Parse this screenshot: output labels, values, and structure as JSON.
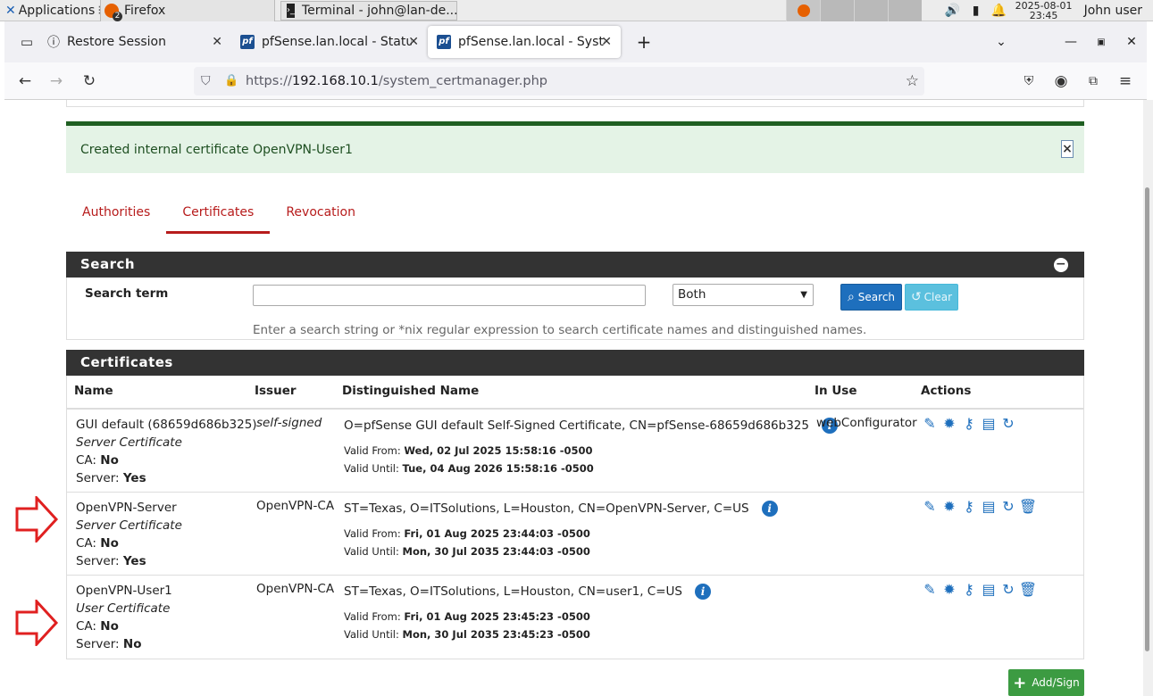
{
  "desktop_panel": {
    "apps_label": "Applications",
    "firefox_task": "Firefox",
    "firefox_badge": "2",
    "terminal_task": "Terminal - john@lan-de...",
    "clock_date": "2025-08-01",
    "clock_time": "23:45",
    "user": "John user"
  },
  "browser": {
    "tabs": [
      {
        "label": "Restore Session"
      },
      {
        "label": "pfSense.lan.local - Status"
      },
      {
        "label": "pfSense.lan.local - System"
      }
    ],
    "url_scheme": "https://",
    "url_host": "192.168.10.1",
    "url_path": "/system_certmanager.php"
  },
  "alert": {
    "message": "Created internal certificate OpenVPN-User1",
    "close": "×"
  },
  "page_tabs": [
    "Authorities",
    "Certificates",
    "Revocation"
  ],
  "search": {
    "title": "Search",
    "term_label": "Search term",
    "term_value": "",
    "scope_selected": "Both",
    "search_btn": "Search",
    "clear_btn": "Clear",
    "help": "Enter a search string or *nix regular expression to search certificate names and distinguished names."
  },
  "certs": {
    "title": "Certificates",
    "columns": [
      "Name",
      "Issuer",
      "Distinguished Name",
      "In Use",
      "Actions"
    ],
    "rows": [
      {
        "name": "GUI default (68659d686b325)",
        "type": "Server Certificate",
        "ca_label": "CA:",
        "ca": "No",
        "server_label": "Server:",
        "server": "Yes",
        "issuer": "self-signed",
        "dn": "O=pfSense GUI default Self-Signed Certificate, CN=pfSense-68659d686b325",
        "from_label": "Valid From:",
        "valid_from": "Wed, 02 Jul 2025 15:58:16 -0500",
        "until_label": "Valid Until:",
        "valid_until": "Tue, 04 Aug 2026 15:58:16 -0500",
        "in_use": "webConfigurator"
      },
      {
        "name": "OpenVPN-Server",
        "type": "Server Certificate",
        "ca_label": "CA:",
        "ca": "No",
        "server_label": "Server:",
        "server": "Yes",
        "issuer": "OpenVPN-CA",
        "dn": "ST=Texas, O=ITSolutions, L=Houston, CN=OpenVPN-Server, C=US",
        "from_label": "Valid From:",
        "valid_from": "Fri, 01 Aug 2025 23:44:03 -0500",
        "until_label": "Valid Until:",
        "valid_until": "Mon, 30 Jul 2035 23:44:03 -0500",
        "in_use": ""
      },
      {
        "name": "OpenVPN-User1",
        "type": "User Certificate",
        "ca_label": "CA:",
        "ca": "No",
        "server_label": "Server:",
        "server": "No",
        "issuer": "OpenVPN-CA",
        "dn": "ST=Texas, O=ITSolutions, L=Houston, CN=user1, C=US",
        "from_label": "Valid From:",
        "valid_from": "Fri, 01 Aug 2025 23:45:23 -0500",
        "until_label": "Valid Until:",
        "valid_until": "Mon, 30 Jul 2035 23:45:23 -0500",
        "in_use": ""
      }
    ],
    "add_btn": "Add/Sign"
  },
  "colors": {
    "link_red": "#b71c1c",
    "action_blue": "#1e6fbd",
    "panel_dark": "#333333",
    "success_bg": "#e4f3e6",
    "arrow_red": "#e02020"
  }
}
